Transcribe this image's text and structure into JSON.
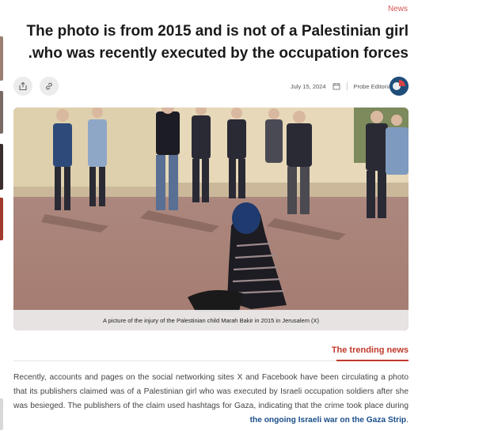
{
  "colors": {
    "accent": "#c0392b",
    "category": "#d9534f",
    "link": "#1a4e8a",
    "button_bg": "#ececec"
  },
  "article": {
    "category": "News",
    "title_line1": "The photo is from 2015 and is not of a Palestinian girl",
    "title_line2": ".who was recently executed by the occupation forces",
    "date": "July 15, 2024",
    "author": "Probe Editorial Team",
    "actions": [
      {
        "icon": "share-icon"
      },
      {
        "icon": "link-icon"
      }
    ],
    "image_caption": "A picture of the injury of the Palestinian child Marah Bakir in 2015 in Jerusalem (X)",
    "trending_label": "The trending news",
    "body_text": "Recently, accounts and pages on the social networking sites X and Facebook have been circulating a photo that its publishers claimed was of a Palestinian girl who was executed by Israeli occupation soldiers after she was besieged. The publishers of the claim used hashtags for Gaza, indicating that the crime took place during",
    "body_link": "the ongoing Israeli war on the Gaza Strip",
    "body_end": "."
  }
}
